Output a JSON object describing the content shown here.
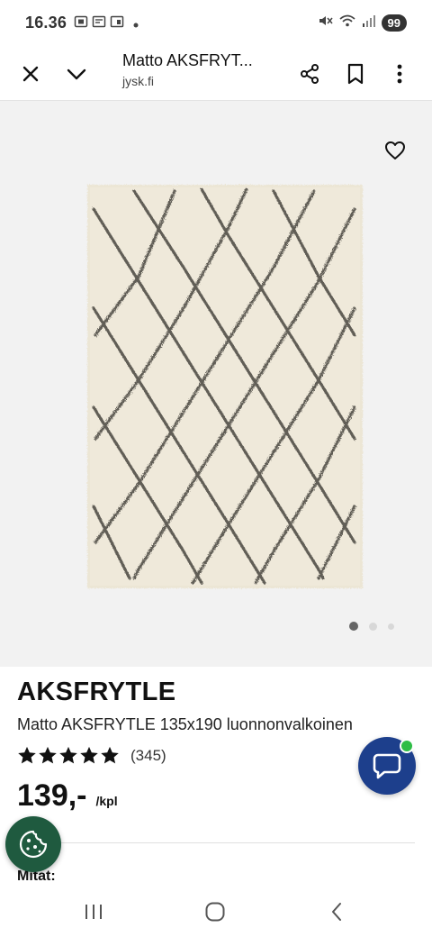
{
  "status_bar": {
    "time": "16.36",
    "battery": "99"
  },
  "toolbar": {
    "title": "Matto AKSFRYT...",
    "domain": "jysk.fi",
    "icons": [
      "close-icon",
      "chevron-down-icon",
      "share-icon",
      "bookmark-icon",
      "more-vertical-icon"
    ]
  },
  "gallery": {
    "image": "rug-product-image",
    "pages": 3,
    "active_page": 1
  },
  "product": {
    "brand": "AKSFRYTLE",
    "subtitle": "Matto AKSFRYTLE 135x190 luonnonvalkoinen",
    "rating": 5,
    "review_count": "(345)",
    "price": "139,-",
    "unit": "/kpl",
    "section_label": "Mitat:"
  },
  "colors": {
    "chat_fab": "#1d3f8c",
    "chat_badge": "#2ebd46",
    "cookie_fab": "#1f5a3f",
    "gallery_bg": "#f2f2f2"
  }
}
